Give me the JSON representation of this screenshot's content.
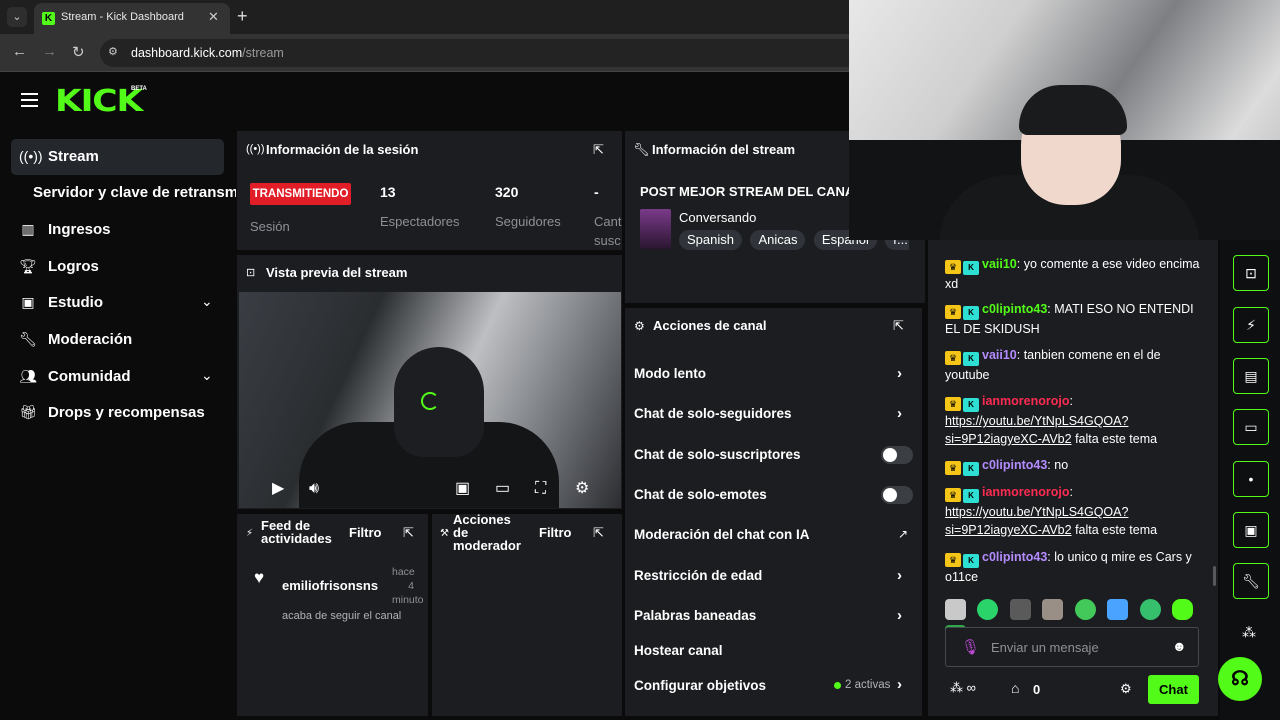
{
  "browser": {
    "tab_title": "Stream - Kick Dashboard",
    "url_host": "dashboard.kick.com",
    "url_path": "/stream"
  },
  "logo": {
    "text": "KICK",
    "beta": "BETA"
  },
  "sidebar": {
    "items": [
      {
        "label": "Stream",
        "icon": "broadcast-icon",
        "active": true
      },
      {
        "label": "Servidor y clave de retransmisión"
      },
      {
        "label": "Ingresos",
        "icon": "bar-chart-icon"
      },
      {
        "label": "Logros",
        "icon": "trophy-icon"
      },
      {
        "label": "Estudio",
        "icon": "studio-icon"
      },
      {
        "label": "Moderación",
        "icon": "wrench-icon"
      },
      {
        "label": "Comunidad",
        "icon": "community-icon"
      },
      {
        "label": "Drops y recompensas",
        "icon": "gift-icon"
      }
    ]
  },
  "session": {
    "title": "Información de la sesión",
    "status": "TRANSMITIENDO",
    "status_label": "Sesión",
    "viewers": "13",
    "viewers_label": "Espectadores",
    "followers": "320",
    "followers_label": "Seguidores",
    "subs": "-",
    "subs_label_1": "Cant",
    "subs_label_2": "susc"
  },
  "stream_info": {
    "title": "Información del stream",
    "stream_title": "POST MEJOR STREAM DEL CANAL",
    "category": "Conversando",
    "tags": [
      "Spanish",
      "Anicas",
      "Español",
      "r..."
    ]
  },
  "preview": {
    "title": "Vista previa del stream"
  },
  "feed": {
    "title_1": "Feed de",
    "title_2": "actividades",
    "filter": "Filtro",
    "user": "emiliofrisonsns",
    "time_1": "hace",
    "time_2": "4",
    "time_3": "minuto",
    "event": "acaba de seguir el canal"
  },
  "mod_actions": {
    "title_1": "Acciones",
    "title_2": "de",
    "title_3": "moderador",
    "filter": "Filtro"
  },
  "channel_actions": {
    "title": "Acciones de canal",
    "items": [
      {
        "label": "Modo lento"
      },
      {
        "label": "Chat de solo-seguidores"
      },
      {
        "label": "Chat de solo-suscriptores"
      },
      {
        "label": "Chat de solo-emotes"
      },
      {
        "label": "Moderación del chat con IA"
      },
      {
        "label": "Restricción de edad"
      },
      {
        "label": "Palabras baneadas"
      },
      {
        "label": "Hostear canal"
      },
      {
        "label": "Configurar objetivos",
        "extra": "2 activas"
      }
    ]
  },
  "chat": {
    "messages": [
      {
        "user": "vaii10",
        "color": "green",
        "text": ": yo comente a ese video encima xd"
      },
      {
        "user": "c0lipinto43",
        "color": "green",
        "text": ": MATI ESO NO ENTENDI EL DE SKIDUSH"
      },
      {
        "user": "vaii10",
        "color": "purple",
        "text": ": tanbien comene en el de youtube"
      },
      {
        "user": "ianmorenorojo",
        "color": "red",
        "link": "https://youtu.be/YtNpLS4GQOA?si=9P12iagyeXC-AVb2",
        "text": " falta este tema"
      },
      {
        "user": "c0lipinto43",
        "color": "purple",
        "text": ": no"
      },
      {
        "user": "ianmorenorojo",
        "color": "red",
        "link": "https://youtu.be/YtNpLS4GQOA?si=9P12iagyeXC-AVb2",
        "text": " falta este tema"
      },
      {
        "user": "c0lipinto43",
        "color": "purple",
        "text": ": lo unico q mire es Cars y o11ce"
      }
    ],
    "input_placeholder": "Enviar un mensaje",
    "points": "0",
    "send_label": "Chat"
  },
  "colors": {
    "accent": "#53fc18",
    "live": "#e11e28",
    "panel": "#1b1d20"
  }
}
